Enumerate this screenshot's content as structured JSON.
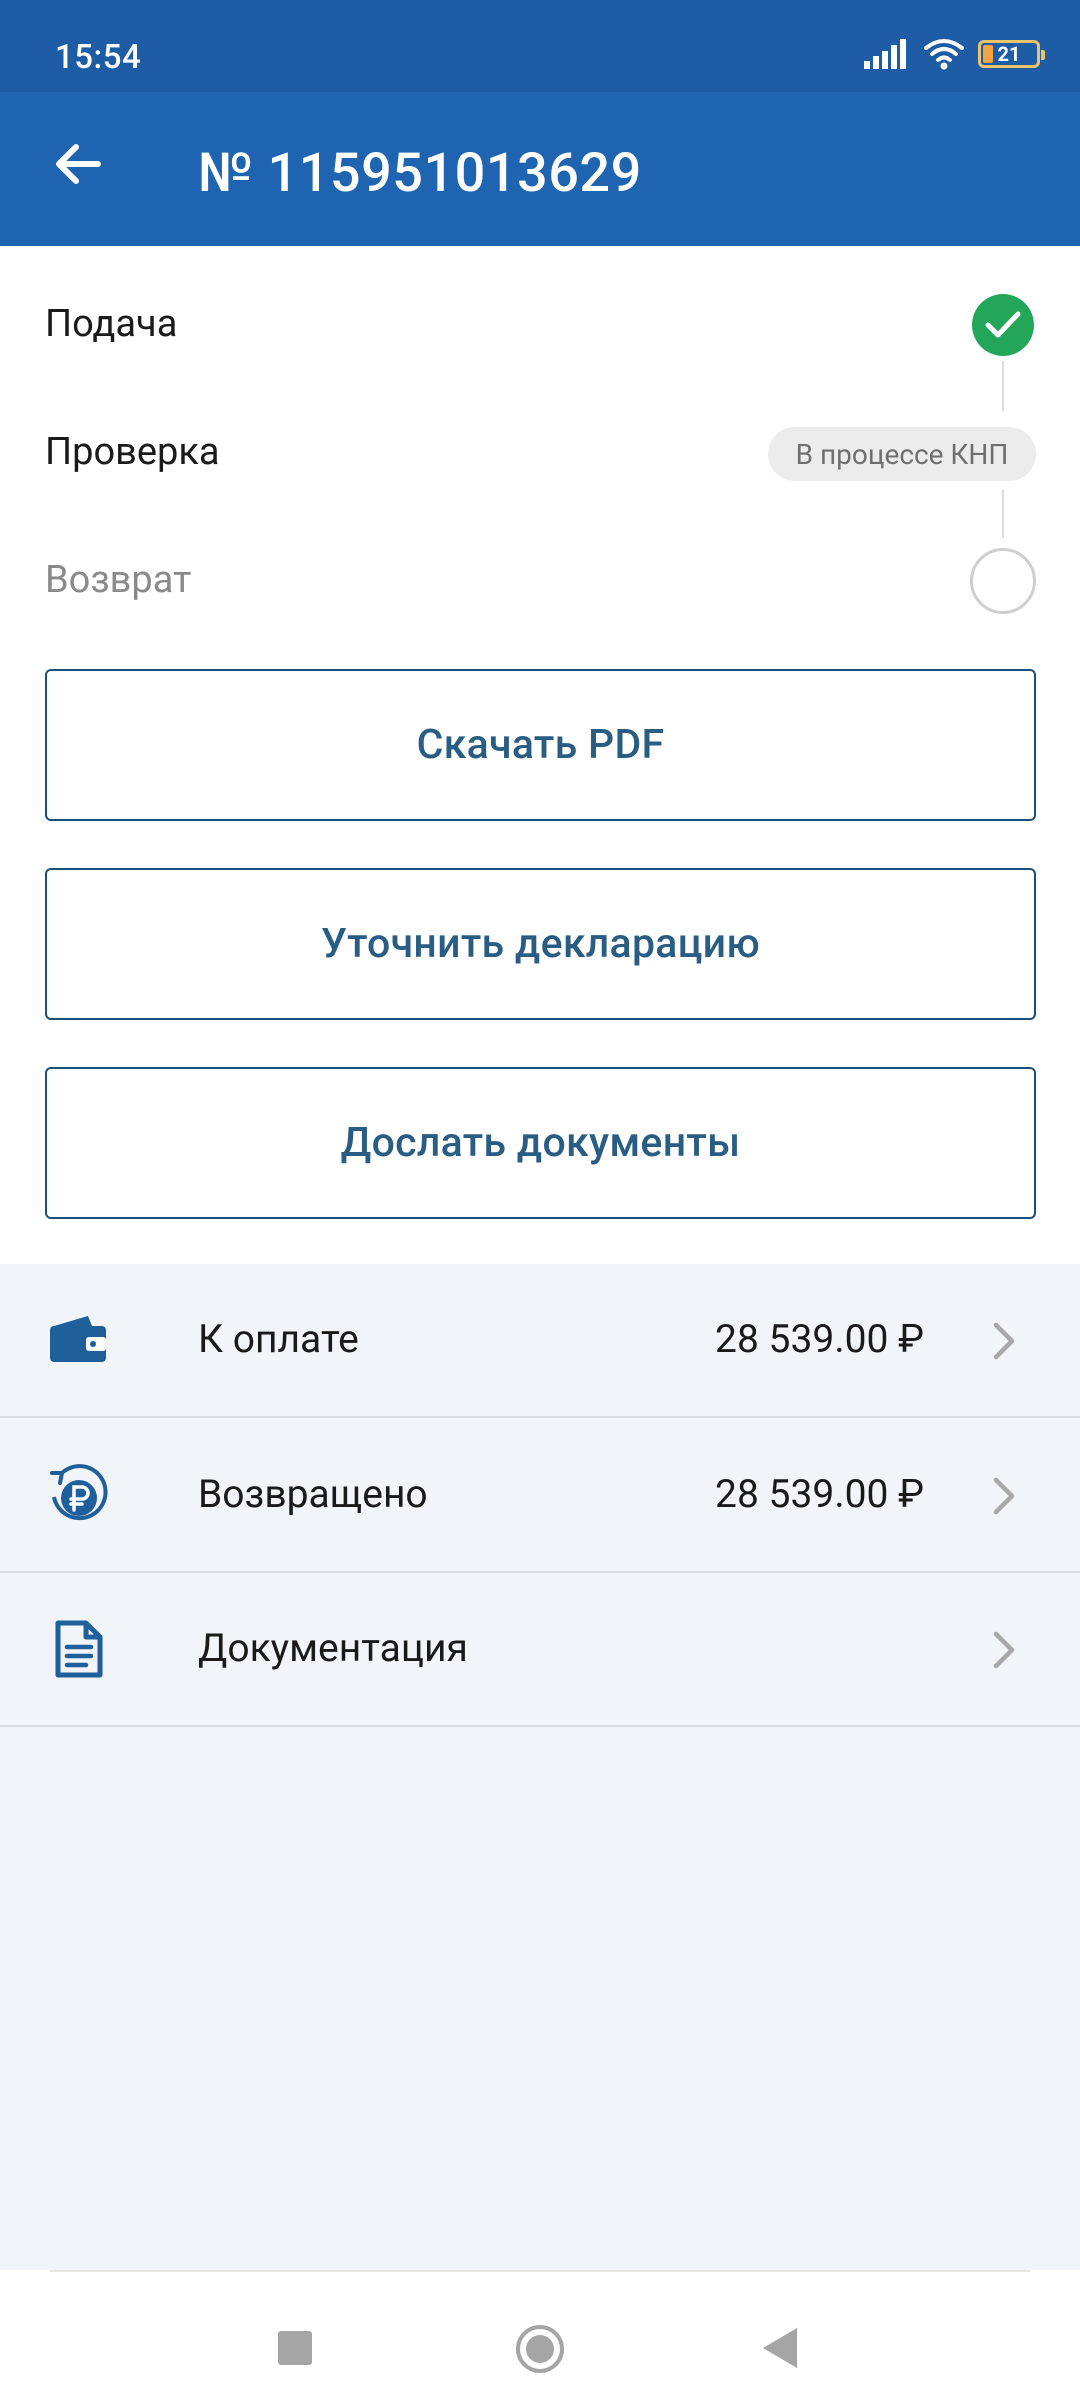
{
  "status_bar": {
    "time": "15:54",
    "battery_level": "21",
    "icons": [
      "signal-icon",
      "wifi-icon",
      "battery-icon"
    ]
  },
  "app_bar": {
    "title": "№ 115951013629",
    "back_icon": "arrow-left-icon"
  },
  "progress_steps": [
    {
      "label": "Подача",
      "state": "done"
    },
    {
      "label": "Проверка",
      "state": "current",
      "badge": "В процессе КНП"
    },
    {
      "label": "Возврат",
      "state": "pending"
    }
  ],
  "buttons": {
    "download_pdf": "Скачать PDF",
    "clarify_declaration": "Уточнить декларацию",
    "send_documents": "Дослать документы"
  },
  "details_list": [
    {
      "icon": "wallet-icon",
      "label": "К оплате",
      "amount": "28 539.00 ₽"
    },
    {
      "icon": "ruble-refund-icon",
      "label": "Возвращено",
      "amount": "28 539.00 ₽"
    },
    {
      "icon": "document-icon",
      "label": "Документация",
      "amount": ""
    }
  ],
  "colors": {
    "status_bar": "#1f5ca6",
    "app_bar": "#1f64b0",
    "success": "#24a65a",
    "button_text": "#2a5d84",
    "button_border": "#1d5079",
    "list_background": "#f1f5f9"
  }
}
